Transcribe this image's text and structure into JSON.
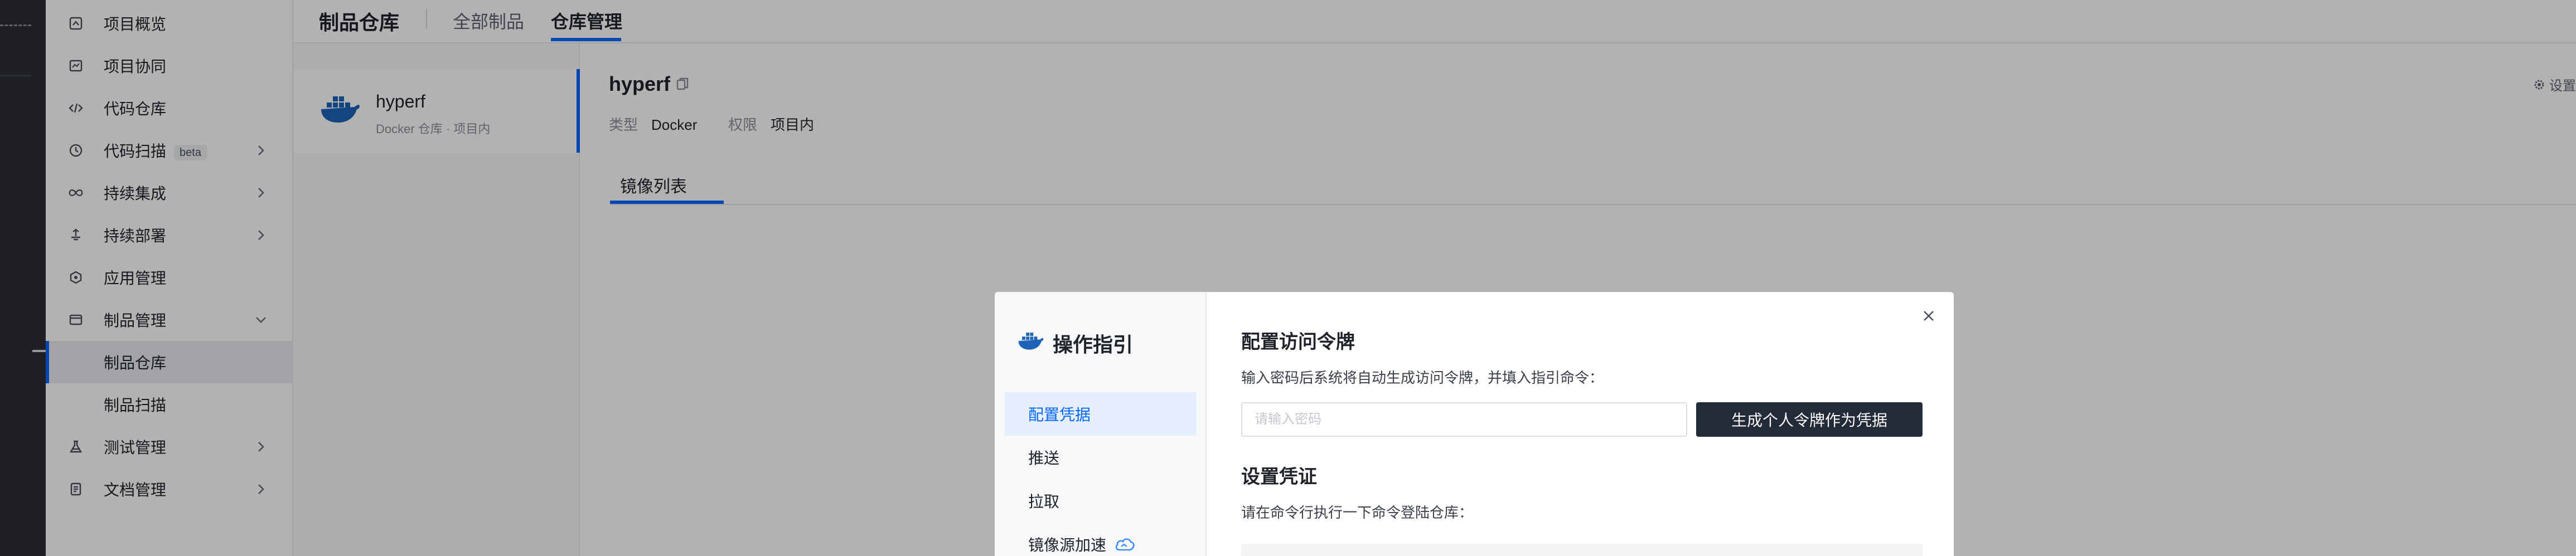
{
  "sidebar": {
    "items": [
      {
        "label": "项目概览",
        "icon": "overview-icon"
      },
      {
        "label": "项目协同",
        "icon": "collaboration-icon"
      },
      {
        "label": "代码仓库",
        "icon": "code-icon"
      },
      {
        "label": "代码扫描",
        "icon": "scan-icon",
        "badge": "beta"
      },
      {
        "label": "持续集成",
        "icon": "infinity-icon"
      },
      {
        "label": "持续部署",
        "icon": "deploy-icon"
      },
      {
        "label": "应用管理",
        "icon": "app-icon"
      },
      {
        "label": "制品管理",
        "icon": "artifact-icon"
      },
      {
        "label": "制品仓库"
      },
      {
        "label": "制品扫描"
      },
      {
        "label": "测试管理",
        "icon": "test-icon"
      },
      {
        "label": "文档管理",
        "icon": "doc-icon"
      }
    ]
  },
  "header": {
    "title": "制品仓库",
    "tabs": [
      {
        "label": "全部制品"
      },
      {
        "label": "仓库管理"
      }
    ]
  },
  "repo_list": {
    "items": [
      {
        "name": "hyperf",
        "meta": "Docker 仓库 · 项目内"
      }
    ]
  },
  "detail": {
    "title": "hyperf",
    "type_label": "类型",
    "type_value": "Docker",
    "perm_label": "权限",
    "perm_value": "项目内",
    "settings_label": "设置",
    "tab_label": "镜像列表"
  },
  "modal": {
    "title": "操作指引",
    "steps": [
      {
        "label": "配置凭据"
      },
      {
        "label": "推送"
      },
      {
        "label": "拉取"
      },
      {
        "label": "镜像源加速"
      }
    ],
    "section1_title": "配置访问令牌",
    "section1_desc": "输入密码后系统将自动生成访问令牌，并填入指引命令：",
    "password_placeholder": "请输入密码",
    "generate_button": "生成个人令牌作为凭据",
    "section2_title": "设置凭证",
    "section2_desc": "请在命令行执行一下命令登陆仓库："
  },
  "colors": {
    "accent": "#0066ff",
    "dark_button": "#232a38",
    "docker_blue": "#1d63b8"
  }
}
